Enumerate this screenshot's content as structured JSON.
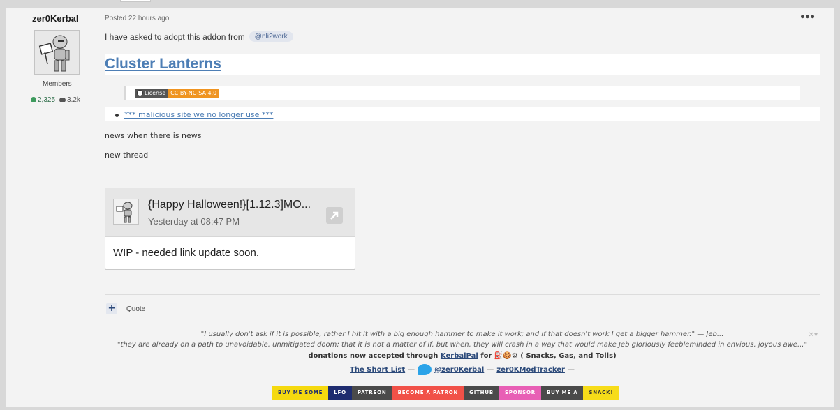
{
  "author": {
    "name": "zer0Kerbal",
    "role": "Members",
    "reputation": "2,325",
    "posts": "3.2k"
  },
  "post": {
    "posted": "Posted 22 hours ago",
    "intro": "I have asked to adopt this addon from",
    "mention": "@nli2work",
    "heading": "Cluster Lanterns",
    "license_label": "License",
    "license_value": "CC BY-NC-SA 4.0",
    "bullet_link": "*** malicious site we no longer use ***",
    "para1": "news when there is news",
    "para2": "new thread",
    "more_menu": "•••"
  },
  "embed": {
    "title": "{Happy Halloween!}[1.12.3]MO...",
    "date": "Yesterday at 08:47 PM",
    "body": "WIP - needed link update soon."
  },
  "actions": {
    "quote_plus": "+",
    "quote_label": "Quote"
  },
  "signature": {
    "quote1": "\"I usually don't ask if it is possible, rather I hit it with a big enough hammer to make it work; and if that doesn't work I get a bigger hammer.\"  — Jeb...",
    "quote2": "\"they are already on a path to unavoidable, unmitigated doom; that it is not a matter of if, but when, they will crash in a way that would make Jeb gloriously feebleminded in envious, joyous awe...\"",
    "donations_prefix": "donations now accepted through",
    "kerbalpal": "KerbalPal",
    "donations_for": "for",
    "donations_suffix": "( Snacks, Gas, and Tolls)",
    "short_list": "The Short List",
    "sep1": "—",
    "twitter_handle": "@zer0Kerbal",
    "sep2": "—",
    "tracker": "zer0KModTracker",
    "sep3": "—",
    "close": "✕▾",
    "badges": [
      {
        "text": "BUY ME SOME",
        "bg": "#f5d90f",
        "fg": "#1e2c6f"
      },
      {
        "text": "LFO",
        "bg": "#1e2c6f",
        "fg": "#ffffff"
      },
      {
        "text": "PATREON",
        "bg": "#4a4a4a",
        "fg": "#ffffff"
      },
      {
        "text": "BECOME A PATRON",
        "bg": "#f15148",
        "fg": "#ffffff"
      },
      {
        "text": "GITHUB",
        "bg": "#4a4a4a",
        "fg": "#ffffff"
      },
      {
        "text": "SPONSOR",
        "bg": "#e85fb5",
        "fg": "#ffffff"
      },
      {
        "text": "BUY ME A",
        "bg": "#4a4a4a",
        "fg": "#ffffff"
      },
      {
        "text": "SNACK!",
        "bg": "#f7dc19",
        "fg": "#333333"
      }
    ]
  }
}
